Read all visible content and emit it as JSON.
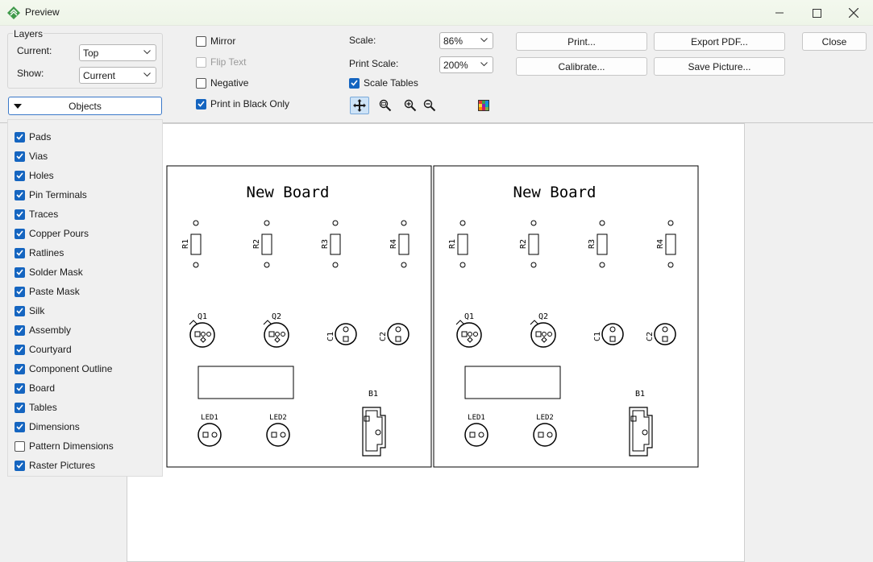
{
  "window": {
    "title": "Preview"
  },
  "layers": {
    "legend": "Layers",
    "current_label": "Current:",
    "current_value": "Top",
    "show_label": "Show:",
    "show_value": "Current"
  },
  "objects": {
    "button_label": "Objects",
    "items": [
      {
        "label": "Pads",
        "checked": true
      },
      {
        "label": "Vias",
        "checked": true
      },
      {
        "label": "Holes",
        "checked": true
      },
      {
        "label": "Pin Terminals",
        "checked": true
      },
      {
        "label": "Traces",
        "checked": true
      },
      {
        "label": "Copper Pours",
        "checked": true
      },
      {
        "label": "Ratlines",
        "checked": true
      },
      {
        "label": "Solder Mask",
        "checked": true
      },
      {
        "label": "Paste Mask",
        "checked": true
      },
      {
        "label": "Silk",
        "checked": true
      },
      {
        "label": "Assembly",
        "checked": true
      },
      {
        "label": "Courtyard",
        "checked": true
      },
      {
        "label": "Component Outline",
        "checked": true
      },
      {
        "label": "Board",
        "checked": true
      },
      {
        "label": "Tables",
        "checked": true
      },
      {
        "label": "Dimensions",
        "checked": true
      },
      {
        "label": "Pattern Dimensions",
        "checked": false
      },
      {
        "label": "Raster Pictures",
        "checked": true
      }
    ]
  },
  "options": {
    "mirror": {
      "label": "Mirror",
      "checked": false
    },
    "flip_text": {
      "label": "Flip Text",
      "checked": false,
      "disabled": true
    },
    "negative": {
      "label": "Negative",
      "checked": false
    },
    "black_only": {
      "label": "Print in Black Only",
      "checked": true
    },
    "scale_tables": {
      "label": "Scale Tables",
      "checked": true
    }
  },
  "scale": {
    "scale_label": "Scale:",
    "scale_value": "86%",
    "print_scale_label": "Print Scale:",
    "print_scale_value": "200%"
  },
  "buttons": {
    "print": "Print...",
    "export_pdf": "Export PDF...",
    "close": "Close",
    "calibrate": "Calibrate...",
    "save_picture": "Save Picture..."
  },
  "board": {
    "title": "New Board",
    "resistors": [
      "R1",
      "R2",
      "R3",
      "R4"
    ],
    "transistors": [
      "Q1",
      "Q2"
    ],
    "capacitors": [
      "C1",
      "C2"
    ],
    "leds": [
      "LED1",
      "LED2"
    ],
    "battery": "B1"
  },
  "colors": {
    "accent": "#1565c0",
    "focus_border": "#3a78c9"
  }
}
